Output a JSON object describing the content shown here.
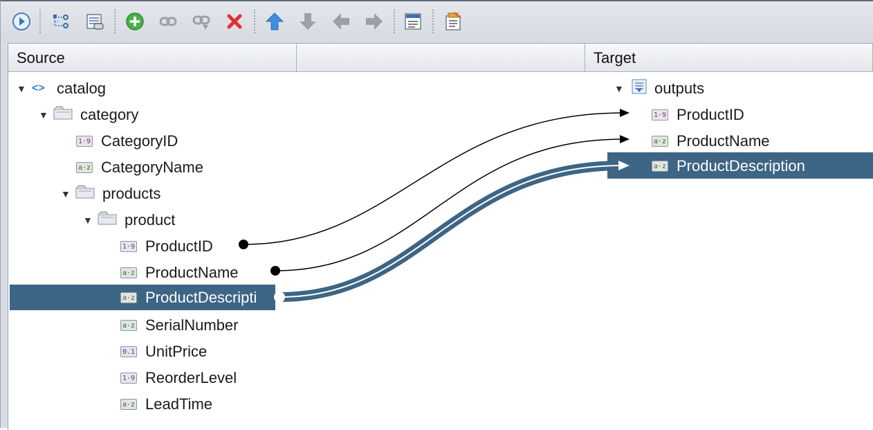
{
  "toolbar": {
    "buttons": [
      {
        "name": "run-icon"
      },
      {
        "name": "tree-structure-icon"
      },
      {
        "name": "table-link-icon"
      },
      {
        "name": "add-icon"
      },
      {
        "name": "link-icon"
      },
      {
        "name": "link-multi-icon"
      },
      {
        "name": "delete-icon"
      },
      {
        "name": "move-up-icon"
      },
      {
        "name": "move-down-icon"
      },
      {
        "name": "move-left-icon"
      },
      {
        "name": "move-right-icon"
      },
      {
        "name": "layout-icon"
      },
      {
        "name": "properties-icon"
      }
    ]
  },
  "columns": {
    "source": "Source",
    "target": "Target"
  },
  "source_tree": {
    "root": "catalog",
    "category": "category",
    "category_fields": [
      {
        "label": "CategoryID",
        "type": "1·9"
      },
      {
        "label": "CategoryName",
        "type": "a·z"
      }
    ],
    "products": "products",
    "product": "product",
    "product_fields": [
      {
        "label": "ProductID",
        "type": "1·9"
      },
      {
        "label": "ProductName",
        "type": "a·z"
      },
      {
        "label": "ProductDescripti",
        "type": "a·z"
      },
      {
        "label": "SerialNumber",
        "type": "a·z"
      },
      {
        "label": "UnitPrice",
        "type": "0.1"
      },
      {
        "label": "ReorderLevel",
        "type": "1·9"
      },
      {
        "label": "LeadTime",
        "type": "a·z"
      }
    ]
  },
  "target_tree": {
    "root": "outputs",
    "fields": [
      {
        "label": "ProductID",
        "type": "1·9"
      },
      {
        "label": "ProductName",
        "type": "a·z"
      },
      {
        "label": "ProductDescription",
        "type": "a·z"
      }
    ]
  },
  "mappings": [
    {
      "from": "ProductID",
      "to": "ProductID",
      "selected": false
    },
    {
      "from": "ProductName",
      "to": "ProductName",
      "selected": false
    },
    {
      "from": "ProductDescription",
      "to": "ProductDescription",
      "selected": true
    }
  ],
  "colors": {
    "selection": "#3d6585",
    "link": "#000000"
  }
}
